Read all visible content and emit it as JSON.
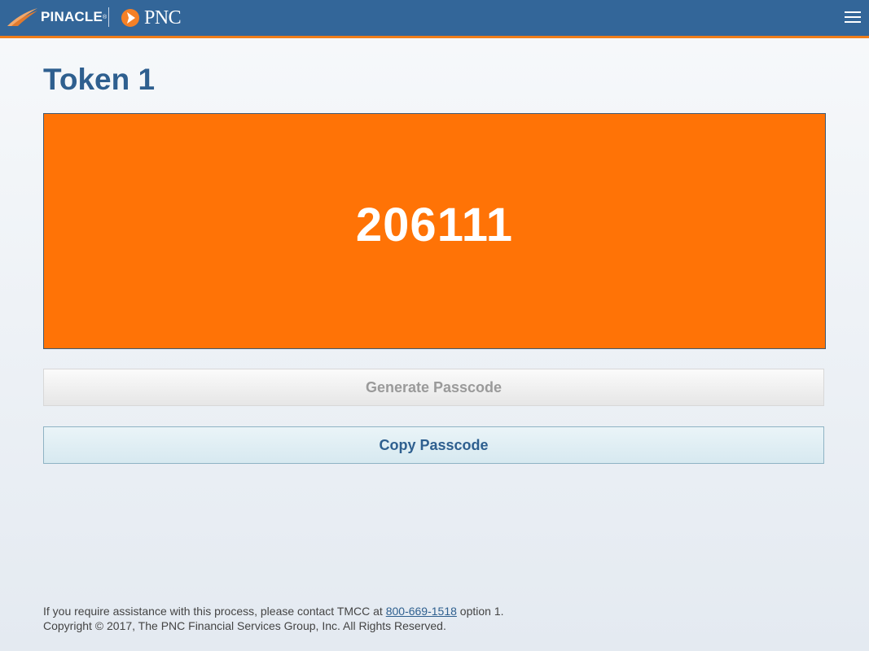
{
  "header": {
    "brand_primary": "PINACLE",
    "brand_primary_mark": "®",
    "brand_secondary": "PNC",
    "menu_icon": "hamburger-menu-icon",
    "colors": {
      "bar": "#336699",
      "accent": "#ef7d1a"
    }
  },
  "page": {
    "title": "Token 1"
  },
  "token": {
    "passcode": "206111",
    "box_color": "#ff7306"
  },
  "actions": {
    "generate_label": "Generate Passcode",
    "copy_label": "Copy Passcode"
  },
  "footer": {
    "help_prefix": "If you require assistance with this process, please contact TMCC at",
    "phone": "800-669-1518",
    "help_suffix": "option 1.",
    "copyright": "Copyright © 2017, The PNC Financial Services Group, Inc. All Rights Reserved."
  }
}
